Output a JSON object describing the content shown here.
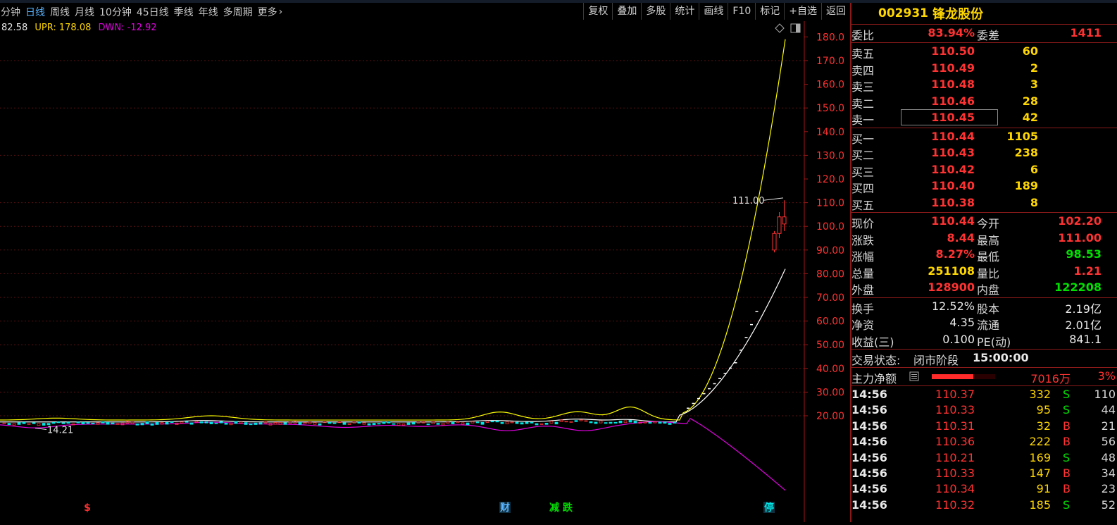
{
  "menu": {
    "periods": [
      {
        "label": "分钟",
        "active": false
      },
      {
        "label": "日线",
        "active": true
      },
      {
        "label": "周线",
        "active": false
      },
      {
        "label": "月线",
        "active": false
      },
      {
        "label": "10分钟",
        "active": false
      },
      {
        "label": "45日线",
        "active": false
      },
      {
        "label": "季线",
        "active": false
      },
      {
        "label": "年线",
        "active": false
      },
      {
        "label": "多周期",
        "active": false
      },
      {
        "label": "更多",
        "active": false
      }
    ],
    "tools": [
      "复权",
      "叠加",
      "多股",
      "统计",
      "画线",
      "F10",
      "标记",
      "+自选",
      "返回"
    ]
  },
  "legend": {
    "mid": "82.58",
    "upr_label": "UPR:",
    "upr": "178.08",
    "dwn_label": "DWN:",
    "dwn": "-12.92"
  },
  "chart_data": {
    "type": "candlestick",
    "y_ticks": [
      "180.0",
      "170.0",
      "160.0",
      "150.0",
      "140.0",
      "130.0",
      "120.0",
      "110.0",
      "100.0",
      "90.00",
      "80.00",
      "70.00",
      "60.00",
      "50.00",
      "40.00",
      "30.00",
      "20.00"
    ],
    "ylim": [
      14,
      183
    ],
    "annotations": {
      "high_marker": "111.00",
      "low_marker": "14.21"
    },
    "event_markers": [
      {
        "label": "$",
        "color": "#ff3232"
      },
      {
        "label": "财",
        "color": "#5ab4ff"
      },
      {
        "label": "减",
        "color": "#00e000"
      },
      {
        "label": "跌",
        "color": "#00e000"
      },
      {
        "label": "停",
        "color": "#00e5e5"
      }
    ],
    "series_colors": {
      "upper": "#ffff00",
      "mid": "#ffffff",
      "lower": "#e000e0",
      "up_candle": "#ff3232",
      "down_candle": "#00e5e5"
    }
  },
  "stock": {
    "code": "002931",
    "name": "锋龙股份"
  },
  "weibi": {
    "label": "委比",
    "value": "83.94%",
    "diff_label": "委差",
    "diff": "1411"
  },
  "asks": [
    {
      "label": "卖五",
      "price": "110.50",
      "vol": "60"
    },
    {
      "label": "卖四",
      "price": "110.49",
      "vol": "2"
    },
    {
      "label": "卖三",
      "price": "110.48",
      "vol": "3"
    },
    {
      "label": "卖二",
      "price": "110.46",
      "vol": "28"
    },
    {
      "label": "卖一",
      "price": "110.45",
      "vol": "42"
    }
  ],
  "bids": [
    {
      "label": "买一",
      "price": "110.44",
      "vol": "1105"
    },
    {
      "label": "买二",
      "price": "110.43",
      "vol": "238"
    },
    {
      "label": "买三",
      "price": "110.42",
      "vol": "6"
    },
    {
      "label": "买四",
      "price": "110.40",
      "vol": "189"
    },
    {
      "label": "买五",
      "price": "110.38",
      "vol": "8"
    }
  ],
  "quote": [
    {
      "l1": "现价",
      "v1": "110.44",
      "c1": "red",
      "l2": "今开",
      "v2": "102.20",
      "c2": "red"
    },
    {
      "l1": "涨跌",
      "v1": "8.44",
      "c1": "red",
      "l2": "最高",
      "v2": "111.00",
      "c2": "red"
    },
    {
      "l1": "涨幅",
      "v1": "8.27%",
      "c1": "red",
      "l2": "最低",
      "v2": "98.53",
      "c2": "grn"
    },
    {
      "l1": "总量",
      "v1": "251108",
      "c1": "yel",
      "l2": "量比",
      "v2": "1.21",
      "c2": "red"
    },
    {
      "l1": "外盘",
      "v1": "128900",
      "c1": "red",
      "l2": "内盘",
      "v2": "122208",
      "c2": "grn"
    }
  ],
  "fundamentals": [
    {
      "l1": "换手",
      "v1": "12.52%",
      "l2": "股本",
      "v2": "2.19亿"
    },
    {
      "l1": "净资",
      "v1": "4.35",
      "l2": "流通",
      "v2": "2.01亿"
    },
    {
      "l1": "收益(三)",
      "v1": "0.100",
      "l2": "PE(动)",
      "v2": "841.1"
    }
  ],
  "status": {
    "label": "交易状态:",
    "value": "闭市阶段",
    "time": "15:00:00"
  },
  "mainflow": {
    "label": "主力净额",
    "amount": "7016万",
    "pct": "3%",
    "bar_fraction": 0.65
  },
  "ticks": [
    {
      "time": "14:56",
      "price": "110.37",
      "vol": "332",
      "side": "S",
      "count": "110"
    },
    {
      "time": "14:56",
      "price": "110.33",
      "vol": "95",
      "side": "S",
      "count": "44"
    },
    {
      "time": "14:56",
      "price": "110.31",
      "vol": "32",
      "side": "B",
      "count": "21"
    },
    {
      "time": "14:56",
      "price": "110.36",
      "vol": "222",
      "side": "B",
      "count": "56"
    },
    {
      "time": "14:56",
      "price": "110.21",
      "vol": "169",
      "side": "S",
      "count": "48"
    },
    {
      "time": "14:56",
      "price": "110.33",
      "vol": "147",
      "side": "B",
      "count": "34"
    },
    {
      "time": "14:56",
      "price": "110.34",
      "vol": "91",
      "side": "B",
      "count": "23"
    },
    {
      "time": "14:56",
      "price": "110.32",
      "vol": "185",
      "side": "S",
      "count": "52"
    }
  ]
}
